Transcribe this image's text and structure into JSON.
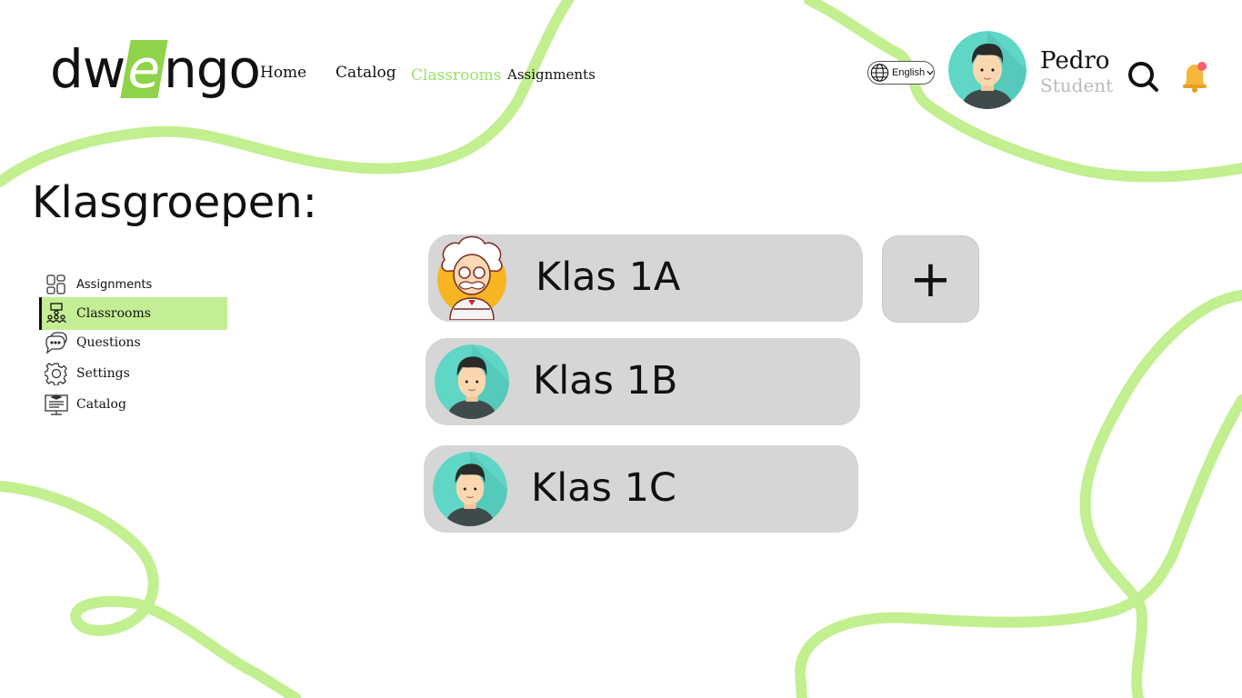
{
  "header": {
    "logo": {
      "pre": "dw",
      "highlight": "e",
      "post": "ngo",
      "accent": "#8ed34a"
    },
    "nav": [
      {
        "label": "Home",
        "active": false
      },
      {
        "label": "Catalog",
        "active": false
      },
      {
        "label": "Classrooms",
        "active": true
      },
      {
        "label": "Assignments",
        "active": false
      }
    ],
    "language": {
      "label": "English",
      "icon": "globe-icon"
    },
    "user": {
      "name": "Pedro",
      "role": "Student"
    },
    "icons": [
      "search-icon",
      "bell-icon"
    ]
  },
  "page": {
    "title": "Klasgroepen:"
  },
  "sidebar": {
    "items": [
      {
        "label": "Assignments",
        "icon": "assignments-icon",
        "active": false
      },
      {
        "label": "Classrooms",
        "icon": "classroom-icon",
        "active": true
      },
      {
        "label": "Questions",
        "icon": "chat-icon",
        "active": false
      },
      {
        "label": "Settings",
        "icon": "gear-icon",
        "active": false
      },
      {
        "label": "Catalog",
        "icon": "catalog-icon",
        "active": false
      }
    ]
  },
  "classes": [
    {
      "name": "Klas 1A",
      "avatar": "professor-avatar"
    },
    {
      "name": "Klas 1B",
      "avatar": "student-avatar"
    },
    {
      "name": "Klas 1C",
      "avatar": "student-avatar"
    }
  ],
  "add_button": {
    "label": "+"
  },
  "colors": {
    "accent": "#9be06a",
    "squiggle": "#c2ef8f",
    "card": "#d6d6d6",
    "active_sidebar": "#c4ee94"
  }
}
